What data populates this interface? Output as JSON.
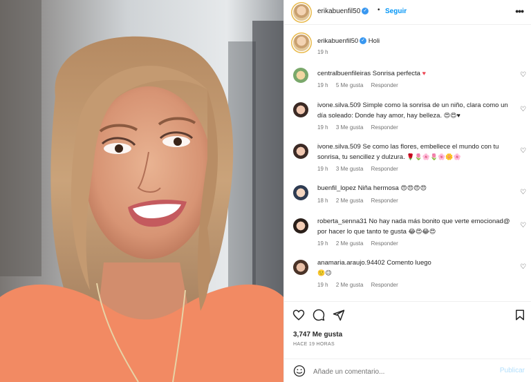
{
  "post": {
    "username": "erikabuenfil50",
    "follow_label": "Seguir",
    "dot": "•",
    "more": "•••"
  },
  "caption": {
    "username": "erikabuenfil50",
    "text": "Holi",
    "time": "19 h"
  },
  "comments": [
    {
      "user": "centralbuenfileiras",
      "text": "Sonrisa perfecta",
      "emoji": "♥",
      "time": "19 h",
      "likes": "5 Me gusta",
      "reply": "Responder"
    },
    {
      "user": "ivone.silva.509",
      "text": "Simple como la sonrisa de un niño, clara como un día soleado: Donde hay amor, hay belleza.",
      "emoji": "😍😍♥",
      "time": "19 h",
      "likes": "3 Me gusta",
      "reply": "Responder"
    },
    {
      "user": "ivone.silva.509",
      "text": "Se como las flores, embellece el mundo con tu sonrisa, tu sencillez y dulzura.",
      "emoji": "🌹🌷🌸🌷🌸🌼🌸",
      "time": "19 h",
      "likes": "3 Me gusta",
      "reply": "Responder"
    },
    {
      "user": "buenfil_lopez",
      "text": "Niña hermosa",
      "emoji": "😍😍😍😍",
      "time": "18 h",
      "likes": "2 Me gusta",
      "reply": "Responder"
    },
    {
      "user": "roberta_senna31",
      "text": "No hay nada más bonito que verte emocionad@ por hacer lo que tanto te gusta",
      "emoji": "😂😍😂😍",
      "time": "19 h",
      "likes": "2 Me gusta",
      "reply": "Responder"
    },
    {
      "user": "anamaria.araujo.94402",
      "text": "Comento luego",
      "emoji": "🙂😉",
      "time": "19 h",
      "likes": "2 Me gusta",
      "reply": "Responder"
    }
  ],
  "stats": {
    "likes": "3,747 Me gusta",
    "ago": "HACE 19 HORAS"
  },
  "composer": {
    "placeholder": "Añade un comentario...",
    "publish_label": "Publicar"
  },
  "icons": {
    "like": "heart-icon",
    "comment": "comment-icon",
    "share": "share-icon",
    "save": "bookmark-icon",
    "emoji": "emoji-icon",
    "verified": "verified-badge-icon",
    "comment_like": "heart-outline-icon"
  },
  "colors": {
    "accent": "#0095f6",
    "heart": "#ed4956",
    "text": "#262626",
    "muted": "#737373",
    "publish_disabled": "#b2dffc"
  }
}
